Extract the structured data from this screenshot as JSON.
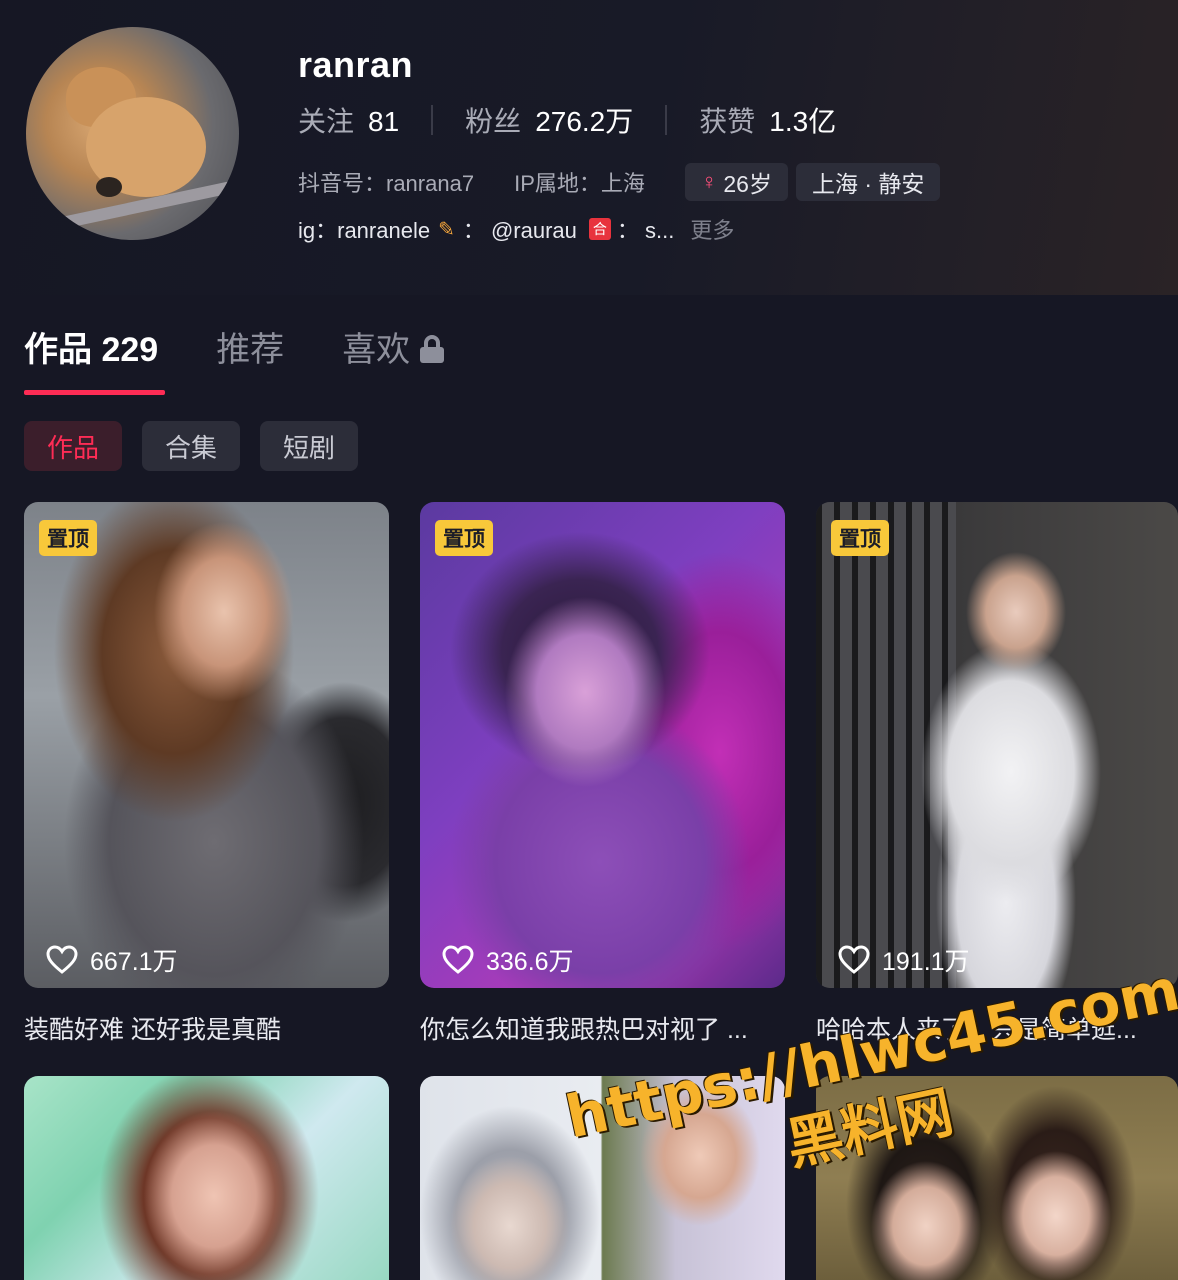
{
  "profile": {
    "username": "ranran",
    "stats": {
      "following_label": "关注",
      "following": "81",
      "followers_label": "粉丝",
      "followers": "276.2万",
      "likes_label": "获赞",
      "likes": "1.3亿"
    },
    "douyin_id": "抖音号：ranrana7",
    "ip_location": "IP属地：上海",
    "age_tag": "26岁",
    "location_tag": "上海 · 静安",
    "bio": {
      "part1": "ig：ranranele",
      "part2": "：  @raurau",
      "he_badge": "合",
      "part3": "：  s...",
      "more": "更多"
    }
  },
  "tabs": {
    "works": "作品 229",
    "recommend": "推荐",
    "likes": "喜欢"
  },
  "chips": [
    "作品",
    "合集",
    "短剧"
  ],
  "videos": [
    {
      "pinned_label": "置顶",
      "likes": "667.1万",
      "caption": "装酷好难 还好我是真酷"
    },
    {
      "pinned_label": "置顶",
      "likes": "336.6万",
      "caption": "你怎么知道我跟热巴对视了 ..."
    },
    {
      "pinned_label": "置顶",
      "likes": "191.1万",
      "caption": "哈哈本人来了，只是简单逛..."
    }
  ],
  "watermark": {
    "url": "https://hlwc45.com",
    "name": "黑料网"
  },
  "colors": {
    "background": "#161724",
    "accent": "#fe2c55",
    "pin_badge": "#f8c83a",
    "watermark": "#f7b32b"
  },
  "icons": {
    "lock": "lock-icon",
    "heart": "heart-outline-icon",
    "female": "female-icon"
  }
}
